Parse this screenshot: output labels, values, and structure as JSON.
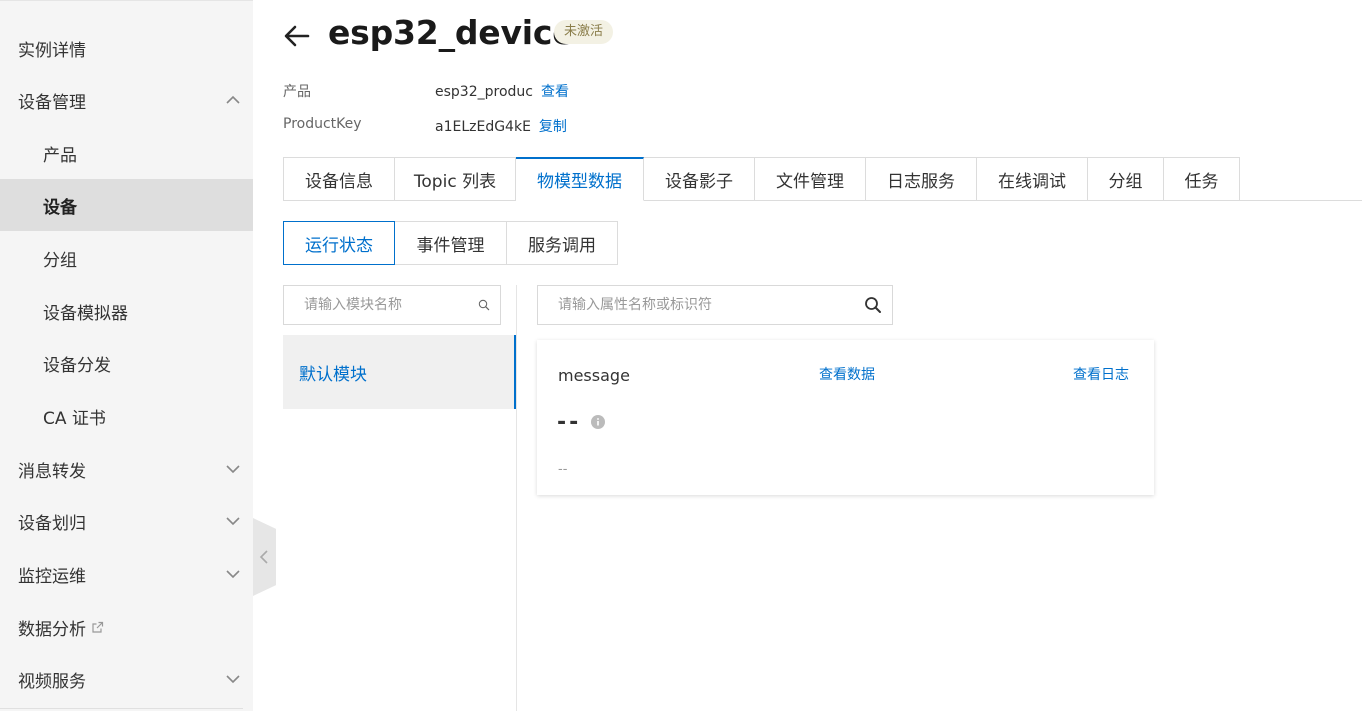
{
  "sidebar": {
    "items": [
      {
        "label": "实例详情"
      },
      {
        "label": "设备管理"
      },
      {
        "label": "产品"
      },
      {
        "label": "设备"
      },
      {
        "label": "分组"
      },
      {
        "label": "设备模拟器"
      },
      {
        "label": "设备分发"
      },
      {
        "label": "CA 证书"
      },
      {
        "label": "消息转发"
      },
      {
        "label": "设备划归"
      },
      {
        "label": "监控运维"
      },
      {
        "label": "数据分析"
      },
      {
        "label": "视频服务"
      }
    ]
  },
  "header": {
    "title": "esp32_device",
    "status": "未激活",
    "product_label": "产品",
    "product_value": "esp32_produc",
    "product_link": "查看",
    "key_label": "ProductKey",
    "key_value": "a1ELzEdG4kE",
    "key_link": "复制"
  },
  "tabs": [
    {
      "label": "设备信息"
    },
    {
      "label": "Topic 列表"
    },
    {
      "label": "物模型数据"
    },
    {
      "label": "设备影子"
    },
    {
      "label": "文件管理"
    },
    {
      "label": "日志服务"
    },
    {
      "label": "在线调试"
    },
    {
      "label": "分组"
    },
    {
      "label": "任务"
    }
  ],
  "subtabs": [
    {
      "label": "运行状态"
    },
    {
      "label": "事件管理"
    },
    {
      "label": "服务调用"
    }
  ],
  "module_search": {
    "placeholder": "请输入模块名称"
  },
  "property_search": {
    "placeholder": "请输入属性名称或标识符"
  },
  "modules": [
    {
      "label": "默认模块"
    }
  ],
  "property": {
    "name": "message",
    "view_data": "查看数据",
    "view_log": "查看日志",
    "value": "--",
    "time": "--"
  },
  "colors": {
    "accent": "#0070cc",
    "sidebar_bg": "#f5f5f5",
    "badge_bg": "#f3f1e4"
  }
}
